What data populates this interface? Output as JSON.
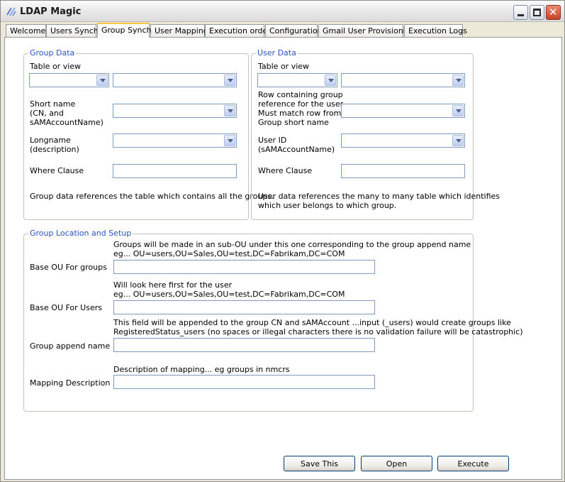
{
  "window": {
    "title": "LDAP Magic",
    "close_glyph": "✕"
  },
  "tabs": [
    {
      "label": "Welcome"
    },
    {
      "label": "Users Synch"
    },
    {
      "label": "Group Synch"
    },
    {
      "label": "User Mapping"
    },
    {
      "label": "Execution order"
    },
    {
      "label": "Configuration"
    },
    {
      "label": "Gmail User Provisioning"
    },
    {
      "label": "Execution Logs"
    }
  ],
  "group_data": {
    "legend": "Group Data",
    "table_label": "Table or view",
    "short_name_label_1": "Short name",
    "short_name_label_2": "(CN, and",
    "short_name_label_3": "sAMAccountName)",
    "longname_label_1": "Longname",
    "longname_label_2": "(description)",
    "where_label": "Where Clause",
    "note": "Group data references the table which contains all the groups."
  },
  "user_data": {
    "legend": "User Data",
    "table_label": "Table or view",
    "row_label_1": "Row containing group",
    "row_label_2": "reference for the user",
    "row_label_3": "Must match row from",
    "row_label_4": "Group short name",
    "userid_label_1": "User ID",
    "userid_label_2": "(sAMAccountName)",
    "where_label": "Where Clause",
    "note_1": "User data references the many to many table which identifies",
    "note_2": "which user belongs to which group."
  },
  "location": {
    "legend": "Group Location and Setup",
    "base_ou_groups_hint_1": "Groups will be made in an sub-OU under this one corresponding to the group append name",
    "base_ou_groups_hint_2": "eg...  OU=users,OU=Sales,OU=test,DC=Fabrikam,DC=COM",
    "base_ou_groups_label": "Base OU For groups",
    "base_ou_users_hint_1": "Will look here first for the user",
    "base_ou_users_hint_2": "eg...  OU=users,OU=Sales,OU=test,DC=Fabrikam,DC=COM",
    "base_ou_users_label": "Base OU For Users",
    "append_hint_1": "This field will be appended to the group CN and sAMAccount  ...input (_users) would create groups like",
    "append_hint_2": "RegisteredStatus_users (no spaces or illegal characters there is no validation failure will be catastrophic)",
    "append_label": "Group append name",
    "mapping_hint": "Description of mapping... eg groups in nmcrs",
    "mapping_label": "Mapping Description"
  },
  "buttons": {
    "save": "Save This",
    "open": "Open",
    "execute": "Execute"
  }
}
